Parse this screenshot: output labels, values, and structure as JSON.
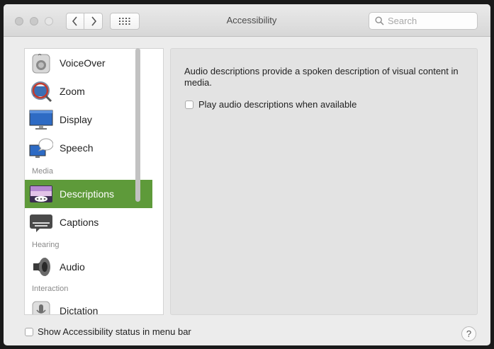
{
  "window": {
    "title": "Accessibility",
    "search_placeholder": "Search"
  },
  "sidebar": {
    "items": [
      {
        "label": "VoiceOver",
        "icon": "voiceover-icon"
      },
      {
        "label": "Zoom",
        "icon": "zoom-icon"
      },
      {
        "label": "Display",
        "icon": "display-icon"
      },
      {
        "label": "Speech",
        "icon": "speech-icon"
      },
      {
        "label": "Descriptions",
        "icon": "descriptions-icon",
        "selected": true
      },
      {
        "label": "Captions",
        "icon": "captions-icon"
      },
      {
        "label": "Audio",
        "icon": "audio-icon"
      },
      {
        "label": "Dictation",
        "icon": "dictation-icon"
      }
    ],
    "sections": [
      "Media",
      "Hearing",
      "Interaction"
    ]
  },
  "content": {
    "description": "Audio descriptions provide a spoken description of visual content in media.",
    "checkbox_label": "Play audio descriptions when available",
    "checkbox_checked": false
  },
  "footer": {
    "status_checkbox_label": "Show Accessibility status in menu bar",
    "status_checkbox_checked": false,
    "help_label": "?"
  },
  "colors": {
    "selection": "#5e9a3a"
  }
}
